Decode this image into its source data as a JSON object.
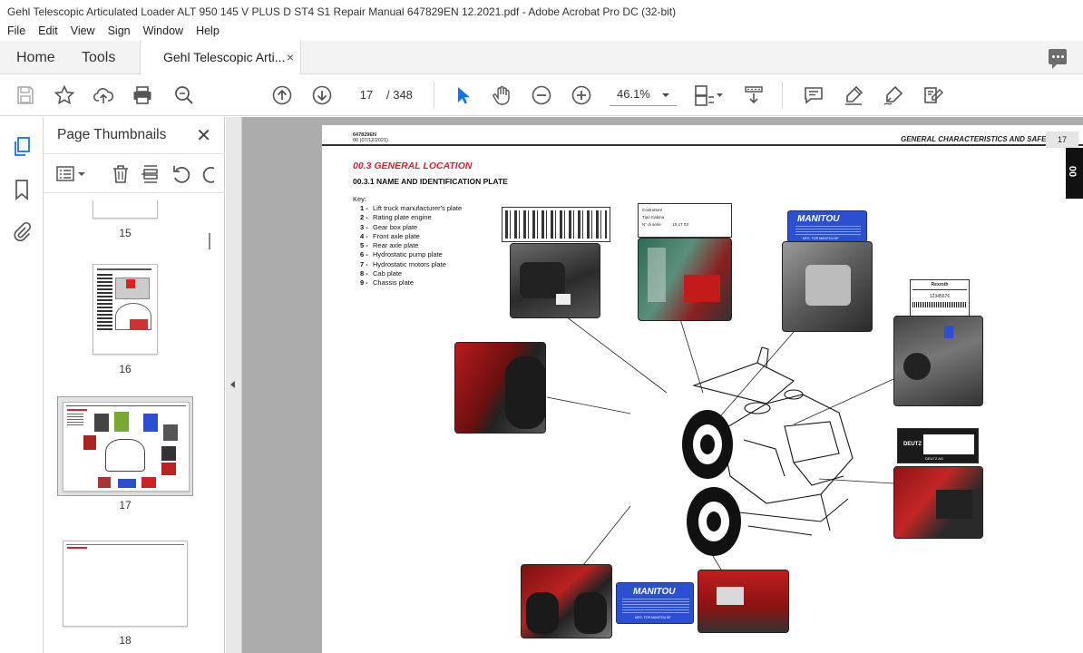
{
  "window": {
    "title": "Gehl Telescopic Articulated Loader ALT 950 145 V PLUS D ST4 S1 Repair Manual 647829EN 12.2021.pdf - Adobe Acrobat Pro DC (32-bit)"
  },
  "menu": [
    "File",
    "Edit",
    "View",
    "Sign",
    "Window",
    "Help"
  ],
  "tabs": {
    "home": "Home",
    "tools": "Tools",
    "document": "Gehl Telescopic Arti...",
    "close": "×"
  },
  "toolbar": {
    "page_current": "17",
    "page_total": "/ 348",
    "zoom": "46.1%"
  },
  "thumbnails": {
    "title": "Page Thumbnails",
    "close": "✕",
    "pages": [
      "15",
      "16",
      "17",
      "18"
    ]
  },
  "pdf_page": {
    "doc_code": "647829EN",
    "doc_date": "00 (07/12/2021)",
    "header_section": "GENERAL CHARACTERISTICS AND SAFETY",
    "page_number": "17",
    "chapter_tab": "00",
    "section_title": "00.3   GENERAL LOCATION",
    "subsection_title": "00.3.1     NAME AND IDENTIFICATION PLATE",
    "key_label": "Key:",
    "key_items": [
      {
        "num": "1 -",
        "text": "Lift truck manufacturer's plate"
      },
      {
        "num": "2 -",
        "text": "Rating plate engine"
      },
      {
        "num": "3 -",
        "text": "Gear box plate"
      },
      {
        "num": "4 -",
        "text": "Front axle plate"
      },
      {
        "num": "5 -",
        "text": "Rear axle plate"
      },
      {
        "num": "6 -",
        "text": "Hydrostatic pump plate"
      },
      {
        "num": "7 -",
        "text": "Hydrostatic motors plate"
      },
      {
        "num": "8 -",
        "text": "Cab plate"
      },
      {
        "num": "9 -",
        "text": "Chassis plate"
      }
    ],
    "plates": {
      "cab_plate": {
        "l1": "Costruttore",
        "l2": "Tipo Cabina",
        "l3": "N° di serie",
        "v3": "19 17 03"
      },
      "manitou_brand": "MANITOU",
      "manitou_caption": "MFG. FOR MANITOU BF",
      "rexroth_brand": "Rexroth",
      "rexroth_serial": "12345676",
      "deutz_brand": "DEUTZ",
      "deutz_caption": "DEUTZ AG"
    }
  },
  "colors": {
    "accent_red": "#e3202a",
    "manitou_blue": "#2c4fd1",
    "acrobat_blue": "#1473e6"
  }
}
